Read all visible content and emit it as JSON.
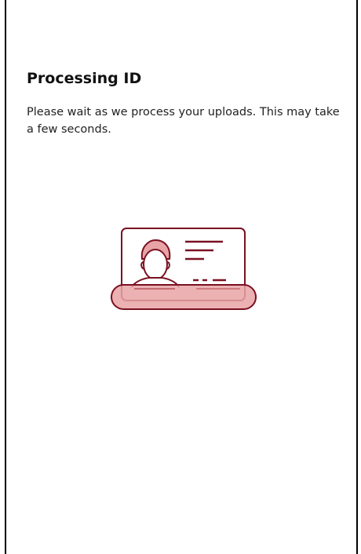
{
  "screen": {
    "title": "Processing ID",
    "description": "Please wait as we process your uploads. This may take a few seconds."
  },
  "illustration": {
    "icon": "id-card-scan-icon",
    "stroke_color": "#7a1020",
    "fill_color": "#e8a3a6",
    "face_color": "#ffffff"
  }
}
